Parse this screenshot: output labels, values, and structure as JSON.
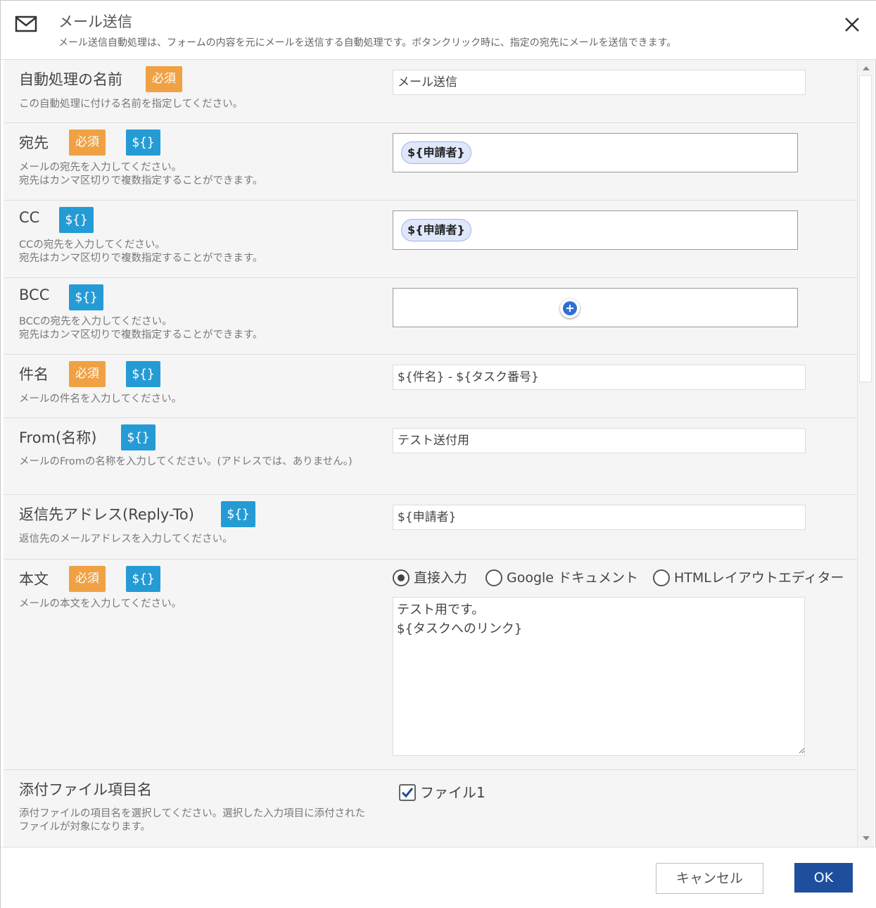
{
  "header": {
    "title": "メール送信",
    "description": "メール送信自動処理は、フォームの内容を元にメールを送信する自動処理です。ボタンクリック時に、指定の宛先にメールを送信できます。"
  },
  "badges": {
    "required": "必須",
    "variable": "${}"
  },
  "fields": {
    "name": {
      "label": "自動処理の名前",
      "help": "この自動処理に付ける名前を指定してください。",
      "value": "メール送信"
    },
    "to": {
      "label": "宛先",
      "help1": "メールの宛先を入力してください。",
      "help2": "宛先はカンマ区切りで複数指定することができます。",
      "chip": "${申請者}"
    },
    "cc": {
      "label": "CC",
      "help1": "CCの宛先を入力してください。",
      "help2": "宛先はカンマ区切りで複数指定することができます。",
      "chip": "${申請者}"
    },
    "bcc": {
      "label": "BCC",
      "help1": "BCCの宛先を入力してください。",
      "help2": "宛先はカンマ区切りで複数指定することができます。"
    },
    "subject": {
      "label": "件名",
      "help": "メールの件名を入力してください。",
      "value": "${件名} - ${タスク番号}"
    },
    "from_name": {
      "label": "From(名称)",
      "help": "メールのFromの名称を入力してください。(アドレスでは、ありません。)",
      "value": "テスト送付用"
    },
    "reply_to": {
      "label": "返信先アドレス(Reply-To)",
      "help": "返信先のメールアドレスを入力してください。",
      "value": "${申請者}"
    },
    "body": {
      "label": "本文",
      "help": "メールの本文を入力してください。",
      "options": [
        "直接入力",
        "Google ドキュメント",
        "HTMLレイアウトエディター"
      ],
      "selected": "直接入力",
      "value": "テスト用です。\n${タスクへのリンク}"
    },
    "attachment": {
      "label": "添付ファイル項目名",
      "help": "添付ファイルの項目名を選択してください。選択した入力項目に添付されたファイルが対象になります。",
      "option": "ファイル1",
      "checked": true
    }
  },
  "footer": {
    "cancel": "キャンセル",
    "ok": "OK"
  },
  "colors": {
    "required": "#f0a144",
    "variable": "#259bd5",
    "primary": "#1d4f9c"
  }
}
